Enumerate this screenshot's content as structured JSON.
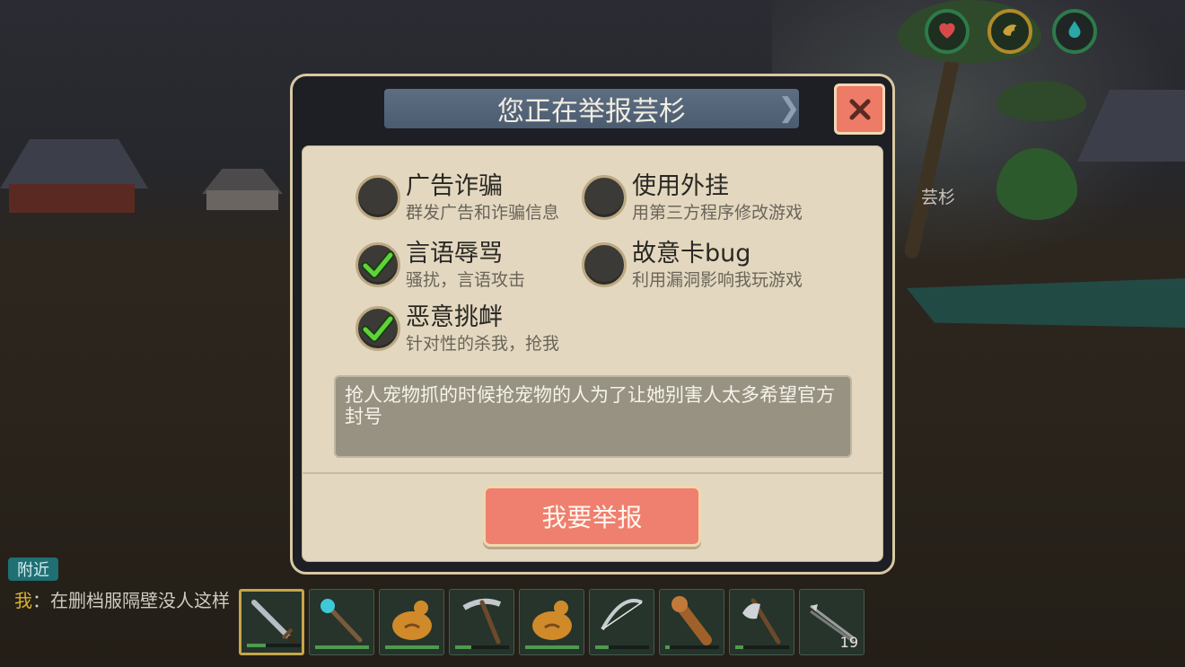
{
  "dialog": {
    "title": "您正在举报芸杉",
    "close_icon": "close-icon",
    "options": [
      {
        "title": "广告诈骗",
        "desc": "群发广告和诈骗信息",
        "checked": false
      },
      {
        "title": "使用外挂",
        "desc": "用第三方程序修改游戏",
        "checked": false
      },
      {
        "title": "言语辱骂",
        "desc": "骚扰，言语攻击",
        "checked": true
      },
      {
        "title": "故意卡bug",
        "desc": "利用漏洞影响我玩游戏",
        "checked": false
      },
      {
        "title": "恶意挑衅",
        "desc": "针对性的杀我，抢我",
        "checked": true
      }
    ],
    "reason_text": "抢人宠物抓的时候抢宠物的人为了让她别害人太多希望官方封号",
    "submit_label": "我要举报"
  },
  "hud": {
    "player_name": "芸杉",
    "stats": [
      {
        "icon": "heart-icon",
        "color": "#d84a4a",
        "ring": "#2e7a4a"
      },
      {
        "icon": "food-icon",
        "color": "#c9a13a",
        "ring": "#b08a2a"
      },
      {
        "icon": "water-drop-icon",
        "color": "#2aa7a7",
        "ring": "#2e7a4a"
      }
    ]
  },
  "chat": {
    "channel": "附近",
    "sender": "我",
    "message": "：在删档服隔壁没人这样"
  },
  "hotbar": {
    "slots": [
      {
        "icon": "sword-icon",
        "selected": true
      },
      {
        "icon": "magic-staff-icon"
      },
      {
        "icon": "gourd-flask-icon"
      },
      {
        "icon": "pickaxe-icon"
      },
      {
        "icon": "gourd-flask-icon"
      },
      {
        "icon": "bow-icon"
      },
      {
        "icon": "club-icon"
      },
      {
        "icon": "battle-axe-icon"
      },
      {
        "icon": "arrow-icon",
        "count": "19"
      }
    ]
  }
}
